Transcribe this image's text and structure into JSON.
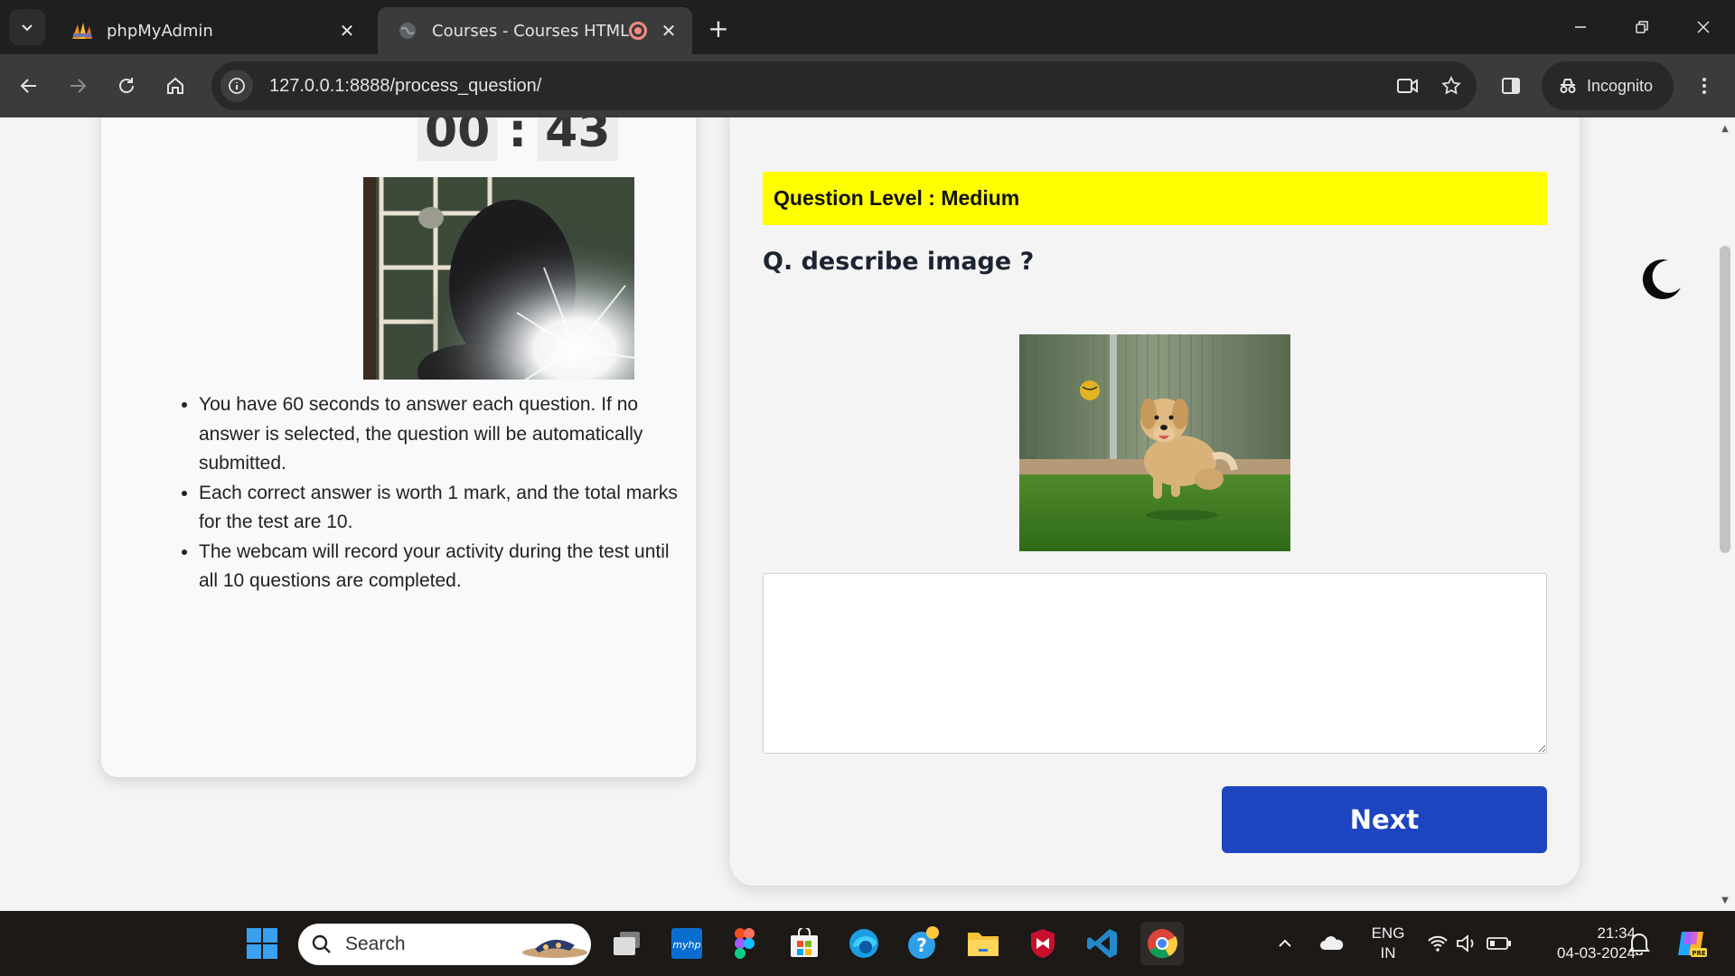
{
  "browser": {
    "tabs": [
      {
        "title": "phpMyAdmin",
        "favicon": "phpmyadmin-logo"
      },
      {
        "title": "Courses - Courses HTML Te",
        "favicon": "globe-icon"
      }
    ],
    "url": "127.0.0.1:8888/process_question/",
    "incognito_label": "Incognito"
  },
  "timer": {
    "minutes": "00",
    "separator": ":",
    "seconds": "43"
  },
  "instructions": [
    "You have 60 seconds to answer each question. If no answer is selected, the question will be automatically submitted.",
    "Each correct answer is worth 1 mark, and the total marks for the test are 10.",
    "The webcam will record your activity during the test until all 10 questions are completed."
  ],
  "question": {
    "level_text": "Question Level : Medium",
    "text": "Q. describe image ?",
    "answer_value": "",
    "next_label": "Next"
  },
  "taskbar": {
    "search_placeholder": "Search",
    "lang_top": "ENG",
    "lang_bottom": "IN",
    "time": "21:34",
    "date": "04-03-2024"
  },
  "colors": {
    "level_bar": "#ffff00",
    "next_button": "#1d45c0",
    "tab_bar": "#1f1f1f",
    "toolbar": "#3b3b3b"
  }
}
